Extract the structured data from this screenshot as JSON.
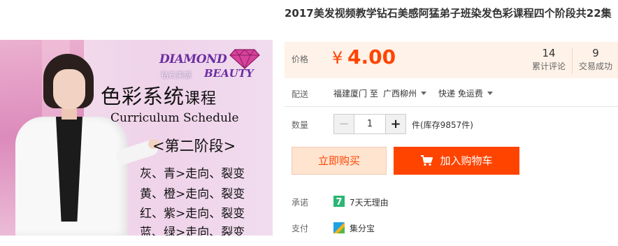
{
  "product": {
    "title": "2017美发视频教学钻石美感阿猛弟子班染发色彩课程四个阶段共22集"
  },
  "image": {
    "logo_word1": "DIAMOND",
    "logo_word2": "BEAUTY",
    "logo_cn": "钻石美感",
    "course_title": "色彩系统",
    "course_title_suffix": "课程",
    "course_title_en": "Curriculum Schedule",
    "stage": "<第二阶段>",
    "lines": [
      "灰、青>走向、裂变",
      "黄、橙>走向、裂变",
      "红、紫>走向、裂变",
      "蓝、绿>走向、裂变"
    ]
  },
  "price": {
    "label": "价格",
    "currency": "¥",
    "value": "4.00",
    "color": "#ff4400"
  },
  "stats": {
    "reviews_count": "14",
    "reviews_label": "累计评论",
    "trades_count": "9",
    "trades_label": "交易成功"
  },
  "shipping": {
    "label": "配送",
    "from": "福建厦门 至",
    "to": "广西柳州",
    "method": "快递 免运费"
  },
  "quantity": {
    "label": "数量",
    "minus": "−",
    "value": "1",
    "plus": "+",
    "stock": "件(库存9857件)"
  },
  "actions": {
    "buy_now": "立即购买",
    "add_to_cart": "加入购物车"
  },
  "promise": {
    "label": "承诺",
    "badge": "7",
    "text": "7天无理由"
  },
  "payment": {
    "label": "支付",
    "text": "集分宝"
  },
  "icons": [
    "diamond-gem-icon",
    "cart-icon",
    "seven-day-badge-icon",
    "jifenbao-icon"
  ]
}
